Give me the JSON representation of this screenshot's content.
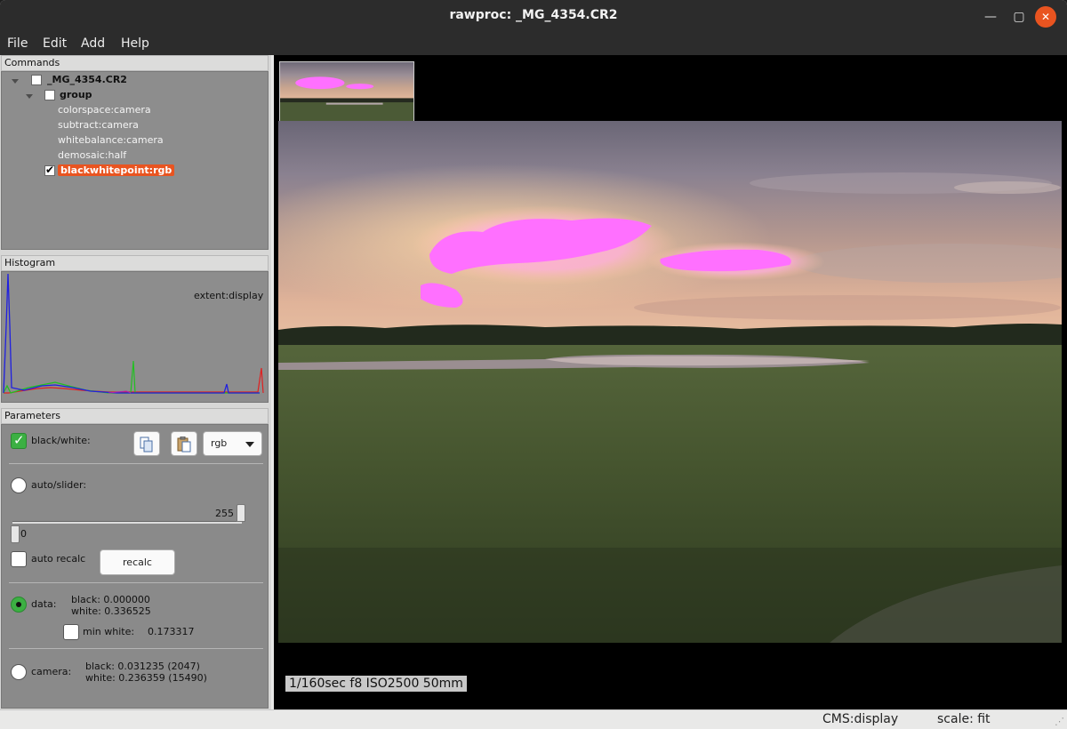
{
  "window": {
    "title": "rawproc: _MG_4354.CR2"
  },
  "menu": [
    "File",
    "Edit",
    "Add",
    "Help"
  ],
  "commands": {
    "header": "Commands",
    "root": "_MG_4354.CR2",
    "group": "group",
    "items": [
      "colorspace:camera",
      "subtract:camera",
      "whitebalance:camera",
      "demosaic:half"
    ],
    "selected": "blackwhitepoint:rgb"
  },
  "histogram": {
    "header": "Histogram",
    "extent": "extent:display"
  },
  "parameters": {
    "header": "Parameters",
    "bw_label": "black/white:",
    "channel": "rgb",
    "auto_slider_label": "auto/slider:",
    "slider_max": "255",
    "slider_min": "0",
    "auto_recalc_label": "auto recalc",
    "recalc_label": "recalc",
    "data_label": "data:",
    "data_black": "black: 0.000000",
    "data_white": "white: 0.336525",
    "min_white_label": "min white:",
    "min_white_value": "0.173317",
    "camera_label": "camera:",
    "camera_black": "black: 0.031235 (2047)",
    "camera_white": "white: 0.236359 (15490)"
  },
  "viewer": {
    "exif": "1/160sec  f8  ISO2500  50mm"
  },
  "status": {
    "cms": "CMS:display",
    "scale": "scale: fit"
  },
  "colors": {
    "accent": "#e95420",
    "check": "#3cb043",
    "clip": "#ff70ff"
  }
}
